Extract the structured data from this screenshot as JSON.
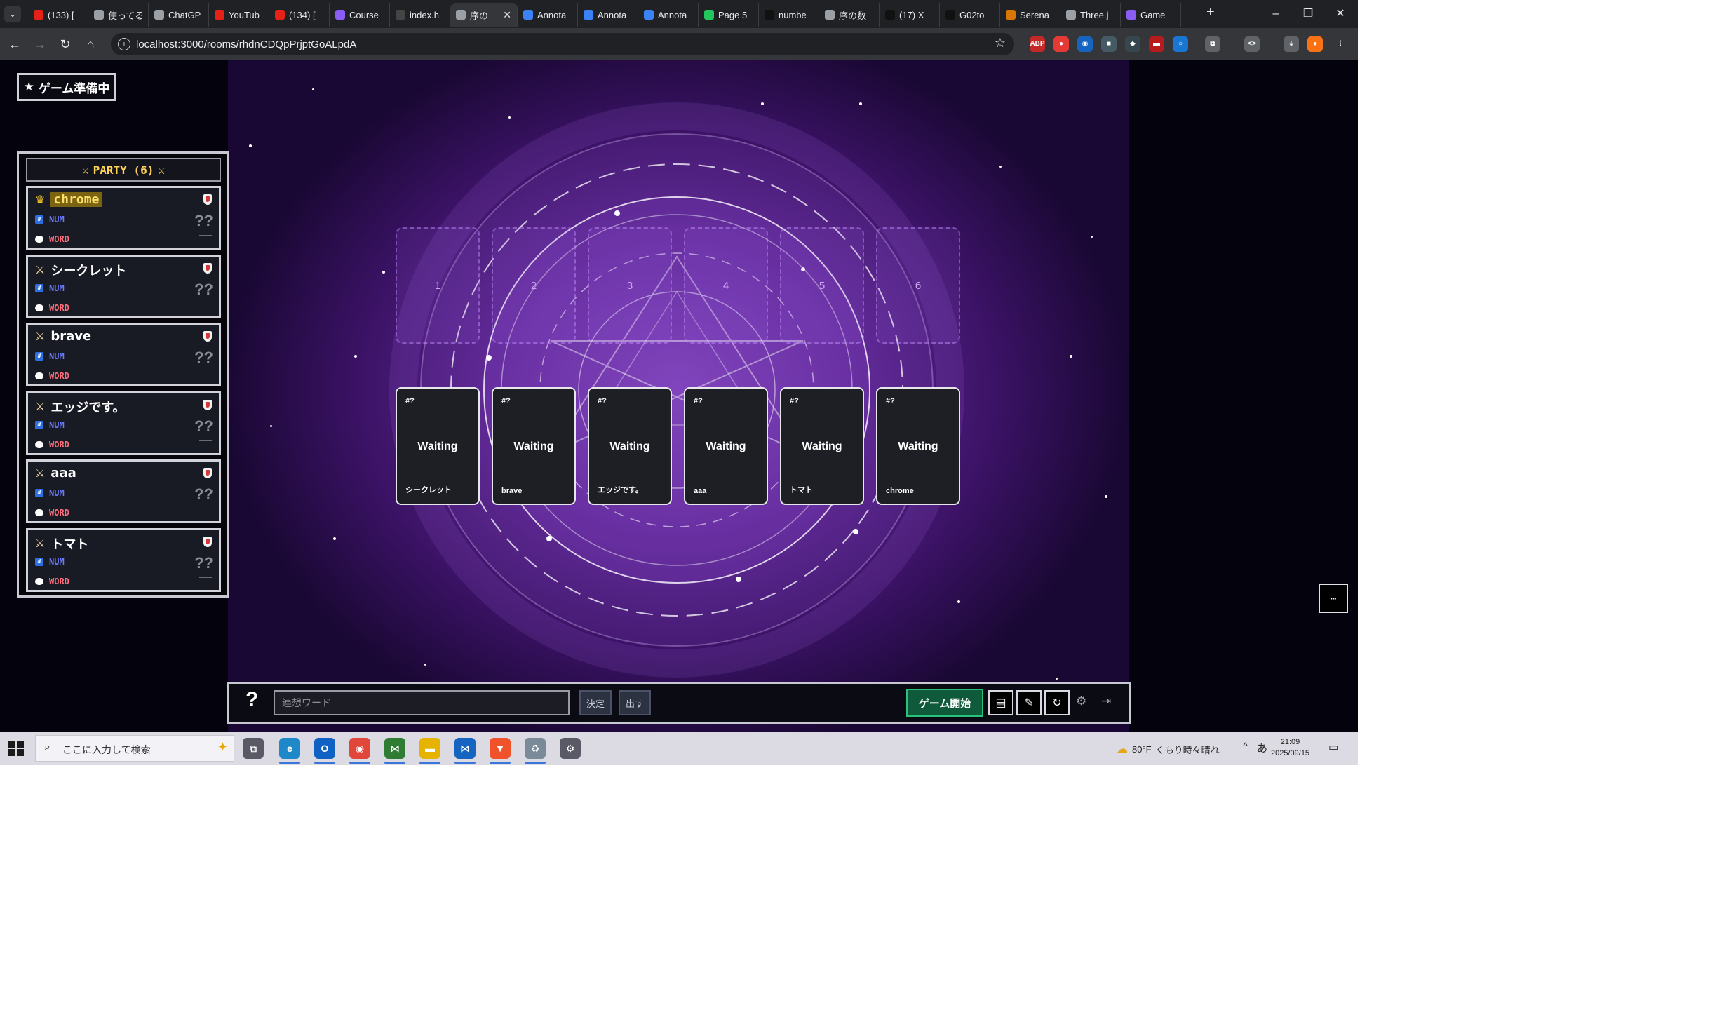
{
  "browser": {
    "tabs": [
      {
        "title": "(133) [",
        "favicon_color": "#e62117"
      },
      {
        "title": "使ってる",
        "favicon_color": "#9aa0a6"
      },
      {
        "title": "ChatGP",
        "favicon_color": "#9aa0a6"
      },
      {
        "title": "YouTub",
        "favicon_color": "#e62117"
      },
      {
        "title": "(134) [",
        "favicon_color": "#e62117"
      },
      {
        "title": "Course",
        "favicon_color": "#8b5cf6"
      },
      {
        "title": "index.h",
        "favicon_color": "#444444"
      },
      {
        "title": "序の",
        "favicon_color": "#9aa0a6",
        "active": true
      },
      {
        "title": "Annota",
        "favicon_color": "#3b82f6"
      },
      {
        "title": "Annota",
        "favicon_color": "#3b82f6"
      },
      {
        "title": "Annota",
        "favicon_color": "#3b82f6"
      },
      {
        "title": "Page 5",
        "favicon_color": "#22c55e"
      },
      {
        "title": "numbe",
        "favicon_color": "#111111"
      },
      {
        "title": "序の数",
        "favicon_color": "#9aa0a6"
      },
      {
        "title": "(17) X",
        "favicon_color": "#111111"
      },
      {
        "title": "G02to",
        "favicon_color": "#111111"
      },
      {
        "title": "Serena",
        "favicon_color": "#d97706"
      },
      {
        "title": "Three.j",
        "favicon_color": "#9aa0a6"
      },
      {
        "title": "Game",
        "favicon_color": "#8b5cf6"
      }
    ],
    "new_tab": "+",
    "window_controls": {
      "minimize": "–",
      "restore": "❐",
      "close": "✕"
    },
    "url": "localhost:3000/rooms/rhdnCDQpPrjptGoALpdA",
    "nav_icons": {
      "back": "←",
      "forward": "→",
      "reload": "↻",
      "home": "⌂"
    },
    "star_icon": "☆",
    "extensions": [
      {
        "label": "ABP",
        "color": "#c62828"
      },
      {
        "label": "●",
        "color": "#e53935"
      },
      {
        "label": "◉",
        "color": "#1565c0"
      },
      {
        "label": "■",
        "color": "#455a64"
      },
      {
        "label": "◆",
        "color": "#37474f"
      },
      {
        "label": "▬",
        "color": "#b71c1c"
      },
      {
        "label": "○",
        "color": "#1976d2"
      },
      {
        "label": "⧉",
        "color": "#5f6368"
      },
      {
        "label": "<>",
        "color": "#5f6368"
      },
      {
        "label": "⤓",
        "color": "#5f6368"
      },
      {
        "label": "●",
        "color": "#f97316"
      },
      {
        "label": "⋮",
        "color": "#35363a"
      }
    ]
  },
  "game": {
    "status": "ゲーム準備中",
    "status_icon": "★",
    "party_title": "PARTY (6)",
    "party_icon": "⚔",
    "players": [
      {
        "name": "chrome",
        "host": true,
        "num_label": "NUM",
        "num_value": "??",
        "word_label": "WORD",
        "word_value": ""
      },
      {
        "name": "シークレット",
        "host": false,
        "num_label": "NUM",
        "num_value": "??",
        "word_label": "WORD",
        "word_value": ""
      },
      {
        "name": "brave",
        "host": false,
        "num_label": "NUM",
        "num_value": "??",
        "word_label": "WORD",
        "word_value": ""
      },
      {
        "name": "エッジです。",
        "host": false,
        "num_label": "NUM",
        "num_value": "??",
        "word_label": "WORD",
        "word_value": ""
      },
      {
        "name": "aaa",
        "host": false,
        "num_label": "NUM",
        "num_value": "??",
        "word_label": "WORD",
        "word_value": ""
      },
      {
        "name": "トマト",
        "host": false,
        "num_label": "NUM",
        "num_value": "??",
        "word_label": "WORD",
        "word_value": ""
      }
    ],
    "slots": [
      "1",
      "2",
      "3",
      "4",
      "5",
      "6"
    ],
    "cards": [
      {
        "id": "#?",
        "status": "Waiting",
        "player": "シークレット"
      },
      {
        "id": "#?",
        "status": "Waiting",
        "player": "brave"
      },
      {
        "id": "#?",
        "status": "Waiting",
        "player": "エッジです。"
      },
      {
        "id": "#?",
        "status": "Waiting",
        "player": "aaa"
      },
      {
        "id": "#?",
        "status": "Waiting",
        "player": "トマト"
      },
      {
        "id": "#?",
        "status": "Waiting",
        "player": "chrome"
      }
    ],
    "controls": {
      "help": "?",
      "word_placeholder": "連想ワード",
      "decide": "決定",
      "submit": "出す",
      "start": "ゲーム開始",
      "icons": {
        "cards": "▤",
        "chat": "✎",
        "refresh": "↻",
        "settings": "⚙",
        "exit": "⇥",
        "chat_bubble": "▪▪▪"
      }
    }
  },
  "taskbar": {
    "search_placeholder": "ここに入力して検索",
    "weather_temp": "80°F",
    "weather_text": "くもり時々晴れ",
    "ime": "あ",
    "time": "21:09",
    "date": "2025/09/15",
    "apps": [
      {
        "name": "task-view",
        "label": "⧉",
        "color": "#5a5a66"
      },
      {
        "name": "edge",
        "label": "e",
        "color": "#1e88c9"
      },
      {
        "name": "outlook",
        "label": "O",
        "color": "#0f62c4"
      },
      {
        "name": "chrome",
        "label": "◉",
        "color": "#e0463a"
      },
      {
        "name": "vs-blue",
        "label": "⋈",
        "color": "#2e7d32"
      },
      {
        "name": "explorer",
        "label": "▬",
        "color": "#e6b400"
      },
      {
        "name": "vscode",
        "label": "⋈",
        "color": "#1565c0"
      },
      {
        "name": "brave",
        "label": "▼",
        "color": "#f0522a"
      },
      {
        "name": "recycle",
        "label": "♻",
        "color": "#7a8a99"
      },
      {
        "name": "settings",
        "label": "⚙",
        "color": "#5a5a66"
      }
    ]
  }
}
